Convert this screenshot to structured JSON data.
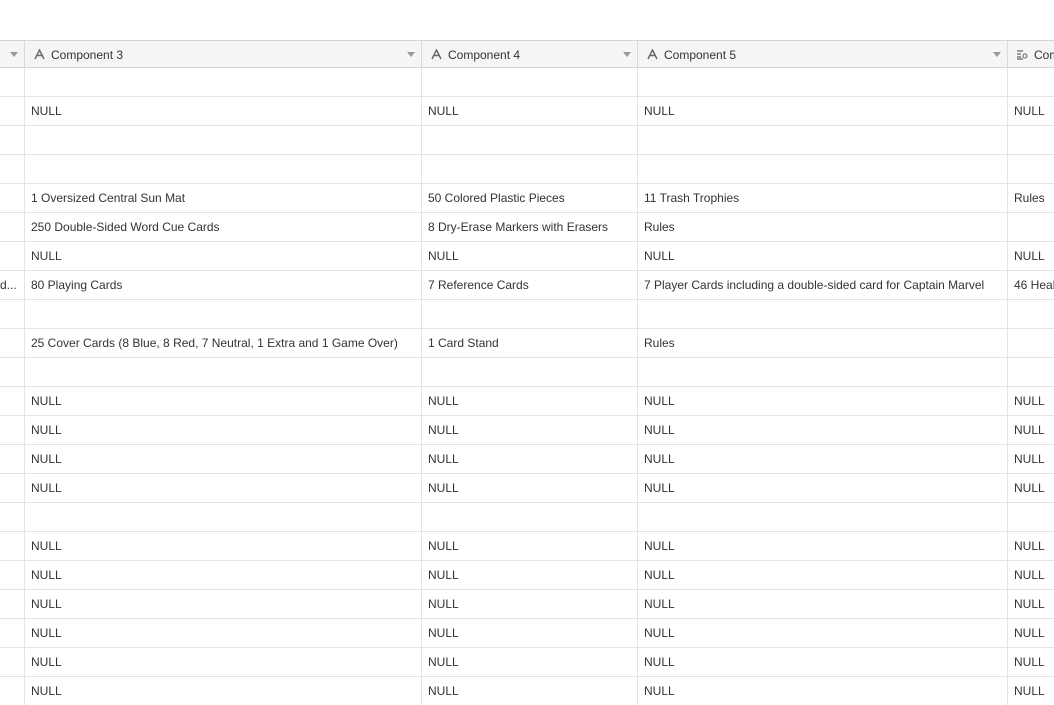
{
  "columns": [
    {
      "label": "",
      "icon": "chevron-down-icon"
    },
    {
      "label": "Component 3",
      "icon": "text-field-icon"
    },
    {
      "label": "Component 4",
      "icon": "text-field-icon"
    },
    {
      "label": "Component 5",
      "icon": "text-field-icon"
    },
    {
      "label": "Com",
      "icon": "long-text-field-icon"
    }
  ],
  "rows": [
    [
      "",
      "",
      "",
      "",
      ""
    ],
    [
      "",
      "NULL",
      "NULL",
      "NULL",
      "NULL"
    ],
    [
      "",
      "",
      "",
      "",
      ""
    ],
    [
      "",
      "",
      "",
      "",
      ""
    ],
    [
      "",
      "1 Oversized Central Sun Mat",
      "50 Colored Plastic Pieces",
      "11 Trash Trophies",
      "Rules"
    ],
    [
      "",
      "250 Double-Sided Word Cue Cards",
      "8 Dry-Erase Markers with Erasers",
      "Rules",
      ""
    ],
    [
      "",
      "NULL",
      "NULL",
      "NULL",
      "NULL"
    ],
    [
      "d...",
      "80 Playing Cards",
      "7 Reference Cards",
      "7 Player Cards including a double-sided card for Captain Marvel",
      "46 Heal"
    ],
    [
      "",
      "",
      "",
      "",
      ""
    ],
    [
      "",
      "25 Cover Cards (8 Blue, 8 Red, 7 Neutral, 1 Extra and 1 Game Over)",
      "1 Card Stand",
      "Rules",
      ""
    ],
    [
      "",
      "",
      "",
      "",
      ""
    ],
    [
      "",
      "NULL",
      "NULL",
      "NULL",
      "NULL"
    ],
    [
      "",
      "NULL",
      "NULL",
      "NULL",
      "NULL"
    ],
    [
      "",
      "NULL",
      "NULL",
      "NULL",
      "NULL"
    ],
    [
      "",
      "NULL",
      "NULL",
      "NULL",
      "NULL"
    ],
    [
      "",
      "",
      "",
      "",
      ""
    ],
    [
      "",
      "NULL",
      "NULL",
      "NULL",
      "NULL"
    ],
    [
      "",
      "NULL",
      "NULL",
      "NULL",
      "NULL"
    ],
    [
      "",
      "NULL",
      "NULL",
      "NULL",
      "NULL"
    ],
    [
      "",
      "NULL",
      "NULL",
      "NULL",
      "NULL"
    ],
    [
      "",
      "NULL",
      "NULL",
      "NULL",
      "NULL"
    ],
    [
      "",
      "NULL",
      "NULL",
      "NULL",
      "NULL"
    ]
  ]
}
